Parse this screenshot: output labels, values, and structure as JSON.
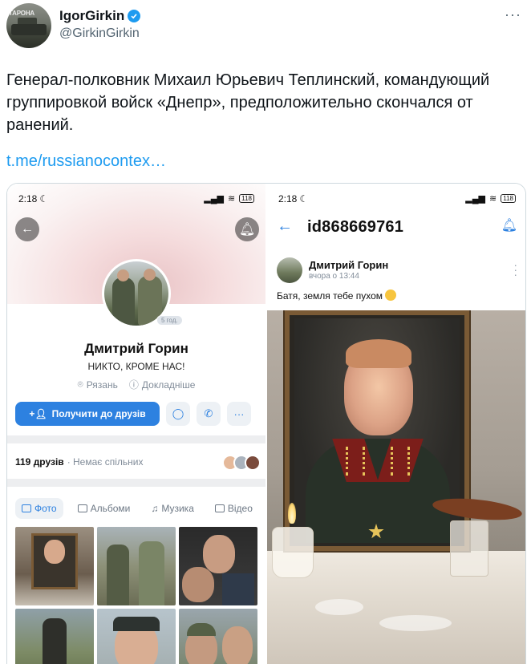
{
  "tweet": {
    "author_name": "IgorGirkin",
    "author_handle": "@GirkinGirkin",
    "avatar_tag": "ТАРОНА",
    "more_icon": "more-horizontal-icon",
    "text": "Генерал-полковник Михаил Юрьевич Теплинский, командующий группировкой войск «Днепр», предположительно скончался от ранений.",
    "link": "t.me/russianocontex…",
    "accent_color": "#1d9bf0"
  },
  "left_screen": {
    "status_time": "2:18",
    "battery": "118",
    "profile_name": "Дмитрий Горин",
    "status_text": "НИКТО, КРОМЕ НАС!",
    "location": "Рязань",
    "details": "Докладніше",
    "online_badge": "5 год.",
    "add_friend_label": "Получити до друзів",
    "friends_count": "119 друзів",
    "friends_mutual": "· Немає спільних",
    "tabs": [
      {
        "label": "Фото",
        "icon": "photo-icon"
      },
      {
        "label": "Альбоми",
        "icon": "album-icon"
      },
      {
        "label": "Музика",
        "icon": "music-icon"
      },
      {
        "label": "Відео",
        "icon": "video-icon"
      }
    ],
    "vk_blue": "#2d81e0"
  },
  "right_screen": {
    "status_time": "2:18",
    "battery": "118",
    "page_id": "id868669761",
    "post_author": "Дмитрий Горин",
    "post_time": "вчора о 13:44",
    "post_text": "Батя, земля тебе пухом"
  }
}
